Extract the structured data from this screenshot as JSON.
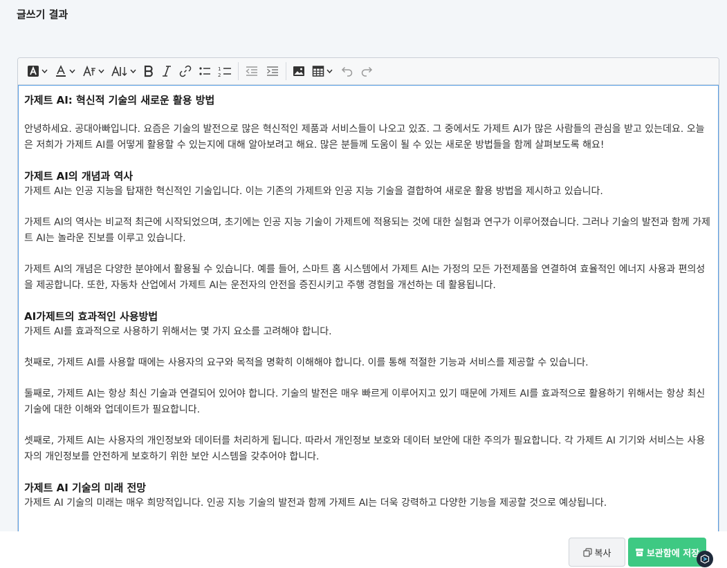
{
  "page": {
    "title": "글쓰기 결과"
  },
  "toolbar": {
    "items": [
      "text-background-icon",
      "font-color-icon",
      "font-format-icon",
      "font-size-icon",
      "bold-icon",
      "italic-icon",
      "link-icon",
      "bullet-list-icon",
      "numbered-list-icon",
      "outdent-icon",
      "indent-icon",
      "image-icon",
      "table-icon",
      "undo-icon",
      "redo-icon"
    ]
  },
  "content": {
    "title": "가제트 AI: 혁신적 기술의 새로운 활용 방법",
    "intro": "안녕하세요. 공대아빠입니다. 요즘은 기술의 발전으로 많은 혁신적인 제품과 서비스들이 나오고 있죠. 그 중에서도 가제트 AI가 많은 사람들의 관심을 받고 있는데요. 오늘은 저희가 가제트 AI를 어떻게 활용할 수 있는지에 대해 알아보려고 해요. 많은 분들께 도움이 될 수 있는 새로운 방법들을 함께 살펴보도록 해요!",
    "s1_heading": "가제트 AI의 개념과 역사",
    "s1_p1": "가제트 AI는 인공 지능을 탑재한 혁신적인 기술입니다. 이는 기존의 가제트와 인공 지능 기술을 결합하여 새로운 활용 방법을 제시하고 있습니다.",
    "s1_p2": "가제트 AI의 역사는 비교적 최근에 시작되었으며, 초기에는 인공 지능 기술이 가제트에 적용되는 것에 대한 실험과 연구가 이루어졌습니다. 그러나 기술의 발전과 함께 가제트 AI는 놀라운 진보를 이루고 있습니다.",
    "s1_p3": "가제트 AI의 개념은 다양한 분야에서 활용될 수 있습니다. 예를 들어, 스마트 홈 시스템에서 가제트 AI는 가정의 모든 가전제품을 연결하여 효율적인 에너지 사용과 편의성을 제공합니다. 또한, 자동차 산업에서 가제트 AI는 운전자의 안전을 증진시키고 주행 경험을 개선하는 데 활용됩니다.",
    "s2_heading": "AI가제트의 효과적인 사용방법",
    "s2_p1": "가제트 AI를 효과적으로 사용하기 위해서는 몇 가지 요소를 고려해야 합니다.",
    "s2_p2": "첫째로, 가제트 AI를 사용할 때에는 사용자의 요구와 목적을 명확히 이해해야 합니다. 이를 통해 적절한 기능과 서비스를 제공할 수 있습니다.",
    "s2_p3": "둘째로, 가제트 AI는 항상 최신 기술과 연결되어 있어야 합니다. 기술의 발전은 매우 빠르게 이루어지고 있기 때문에 가제트 AI를 효과적으로 활용하기 위해서는 항상 최신 기술에 대한 이해와 업데이트가 필요합니다.",
    "s2_p4": "셋째로, 가제트 AI는 사용자의 개인정보와 데이터를 처리하게 됩니다. 따라서 개인정보 보호와 데이터 보안에 대한 주의가 필요합니다. 각 가제트 AI 기기와 서비스는 사용자의 개인정보를 안전하게 보호하기 위한 보안 시스템을 갖추어야 합니다.",
    "s3_heading": "가제트 AI 기술의 미래 전망",
    "s3_p1": "가제트 AI 기술의 미래는 매우 희망적입니다. 인공 지능 기술의 발전과 함께 가제트 AI는 더욱 강력하고 다양한 기능을 제공할 것으로 예상됩니다."
  },
  "actions": {
    "copy_label": "복사",
    "save_label": "보관함에 저장"
  },
  "colors": {
    "accent": "#3ec983",
    "focus_border": "#5aa0e6"
  }
}
